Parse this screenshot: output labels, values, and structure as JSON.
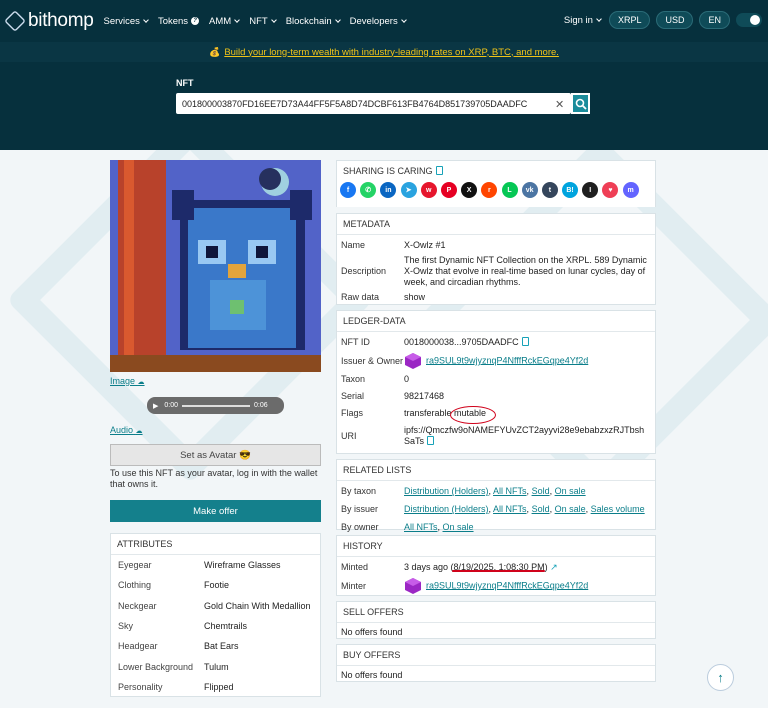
{
  "header": {
    "brand": "bithomp",
    "nav": [
      "Services",
      "Tokens",
      "AMM",
      "NFT",
      "Blockchain",
      "Developers"
    ],
    "signin": "Sign in",
    "network": "XRPL",
    "currency": "USD",
    "language": "EN"
  },
  "promo": {
    "icon": "💰",
    "text": "Build your long-term wealth with industry-leading rates on XRP, BTC, and more."
  },
  "search": {
    "label": "NFT",
    "value": "001800003870FD16EE7D73A44FF5F5A8D74DCBF613FB4764D851739705DAADFC"
  },
  "left": {
    "image_link": "Image",
    "audio_link": "Audio",
    "audio_time": "0:00",
    "audio_duration": "0:06",
    "avatar_button": "Set as Avatar 😎",
    "avatar_note": "To use this NFT as your avatar, log in with the wallet that owns it.",
    "offer_button": "Make offer"
  },
  "attributes": {
    "title": "ATTRIBUTES",
    "rows": [
      {
        "k": "Eyegear",
        "v": "Wireframe Glasses"
      },
      {
        "k": "Clothing",
        "v": "Footie"
      },
      {
        "k": "Neckgear",
        "v": "Gold Chain With Medallion"
      },
      {
        "k": "Sky",
        "v": "Chemtrails"
      },
      {
        "k": "Headgear",
        "v": "Bat Ears"
      },
      {
        "k": "Lower Background",
        "v": "Tulum"
      },
      {
        "k": "Personality",
        "v": "Flipped"
      }
    ]
  },
  "sharing": {
    "title": "SHARING IS CARING",
    "icons": [
      {
        "name": "facebook",
        "glyph": "f",
        "color": "#1877f2"
      },
      {
        "name": "whatsapp",
        "glyph": "✆",
        "color": "#25d366"
      },
      {
        "name": "linkedin",
        "glyph": "in",
        "color": "#0a66c2"
      },
      {
        "name": "telegram",
        "glyph": "➤",
        "color": "#2aa3df"
      },
      {
        "name": "weibo",
        "glyph": "w",
        "color": "#e6162d"
      },
      {
        "name": "pinterest",
        "glyph": "P",
        "color": "#e60023"
      },
      {
        "name": "x",
        "glyph": "X",
        "color": "#111111"
      },
      {
        "name": "reddit",
        "glyph": "r",
        "color": "#ff4500"
      },
      {
        "name": "line",
        "glyph": "L",
        "color": "#06c755"
      },
      {
        "name": "vk",
        "glyph": "vk",
        "color": "#4c75a3"
      },
      {
        "name": "tumblr",
        "glyph": "t",
        "color": "#35465c"
      },
      {
        "name": "hatena",
        "glyph": "B!",
        "color": "#00a4de"
      },
      {
        "name": "instapaper",
        "glyph": "I",
        "color": "#1f1f1f"
      },
      {
        "name": "pocket",
        "glyph": "♥",
        "color": "#ef3f56"
      },
      {
        "name": "mastodon",
        "glyph": "m",
        "color": "#6364ff"
      }
    ]
  },
  "metadata": {
    "title": "METADATA",
    "name_k": "Name",
    "name_v": "X-Owlz #1",
    "desc_k": "Description",
    "desc_v": "The first Dynamic NFT Collection on the XRPL. 589 Dynamic X-Owlz that evolve in real-time based on lunar cycles, day of week, and circadian rhythms.",
    "raw_k": "Raw data",
    "raw_v": "show"
  },
  "ledger": {
    "title": "LEDGER-DATA",
    "nftid_k": "NFT ID",
    "nftid_v": "0018000038...9705DAADFC",
    "owner_k": "Issuer & Owner",
    "owner_v": "ra9SUL9t9wjyznqP4NfffRckEGqpe4Yf2d",
    "taxon_k": "Taxon",
    "taxon_v": "0",
    "serial_k": "Serial",
    "serial_v": "98217468",
    "flags_k": "Flags",
    "flag1": "transferable",
    "flag2": "mutable",
    "uri_k": "URI",
    "uri_v": "ipfs://Qmczfw9oNAMEFYUvZCT2ayyvi28e9ebabzxzRJTbshSaTs"
  },
  "related": {
    "title": "RELATED LISTS",
    "taxon_k": "By taxon",
    "issuer_k": "By issuer",
    "owner_k": "By owner",
    "dist": "Distribution (Holders)",
    "all": "All NFTs",
    "sold": "Sold",
    "onsale": "On sale",
    "volume": "Sales volume"
  },
  "history": {
    "title": "HISTORY",
    "minted_k": "Minted",
    "minted_v": "3 days ago (8/19/2025, 1:08:30 PM)",
    "minter_k": "Minter",
    "minter_v": "ra9SUL9t9wjyznqP4NfffRckEGqpe4Yf2d"
  },
  "sell": {
    "title": "SELL OFFERS",
    "empty": "No offers found"
  },
  "buy": {
    "title": "BUY OFFERS",
    "empty": "No offers found"
  }
}
